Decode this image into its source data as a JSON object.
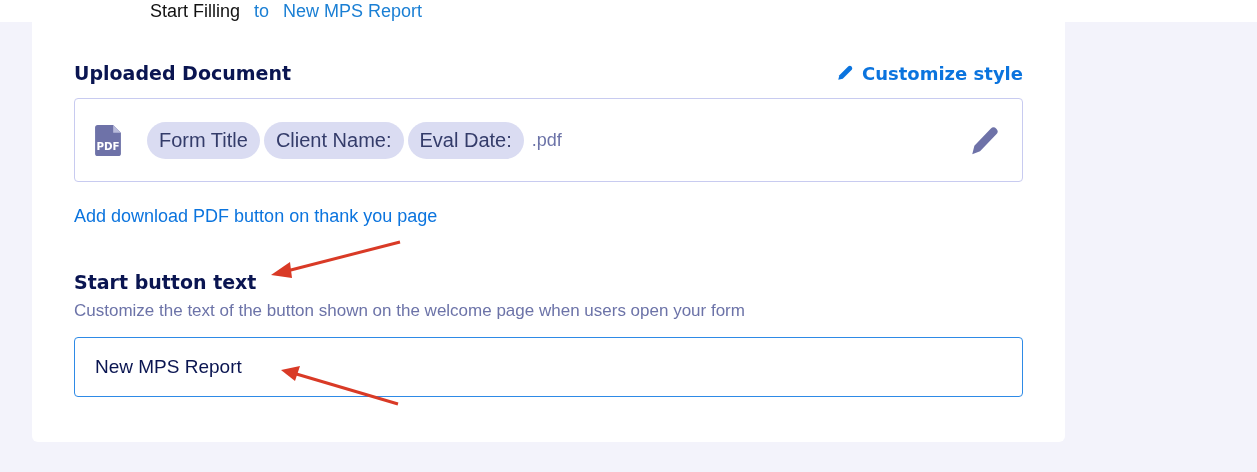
{
  "annotation_caption": {
    "parts": [
      {
        "text": "Start Filling",
        "kind": "plain"
      },
      {
        "text": "to",
        "kind": "link"
      },
      {
        "text": "New MPS Report",
        "kind": "link"
      }
    ]
  },
  "uploaded_document": {
    "label": "Uploaded Document",
    "customize_link": "Customize style",
    "file_icon_label": "PDF",
    "name_tags": [
      "Form Title",
      "Client Name:",
      "Eval Date:"
    ],
    "extension": ".pdf",
    "thank_you_link": "Add download PDF button on thank you page"
  },
  "start_button_text": {
    "label": "Start button text",
    "description": "Customize the text of the button shown on the welcome page when users open your form",
    "value": "New MPS Report"
  }
}
